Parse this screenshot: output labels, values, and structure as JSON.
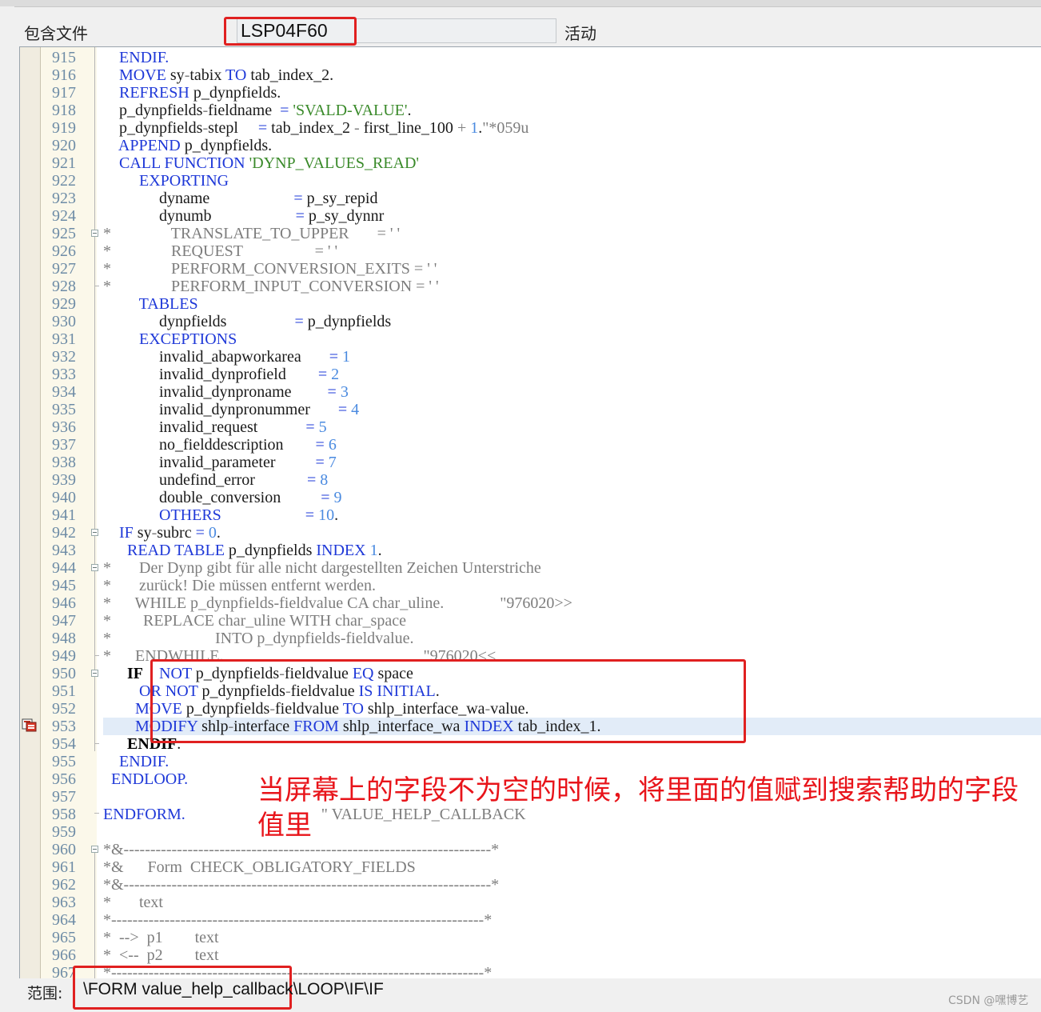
{
  "header": {
    "include_label": "包含文件",
    "include_value": "LSP04F60",
    "status": "活动"
  },
  "editor": {
    "breakpoint_line": "953",
    "lines": [
      {
        "n": "915",
        "t": [
          [
            "k",
            "    ENDIF."
          ]
        ]
      },
      {
        "n": "916",
        "t": [
          [
            "k",
            "    MOVE"
          ],
          [
            "p",
            " sy"
          ],
          [
            "c",
            "-"
          ],
          [
            "p",
            "tabix "
          ],
          [
            "k",
            "TO"
          ],
          [
            "p",
            " tab_index_2."
          ]
        ]
      },
      {
        "n": "917",
        "t": [
          [
            "k",
            "    REFRESH"
          ],
          [
            "p",
            " p_dynpfields."
          ]
        ]
      },
      {
        "n": "918",
        "t": [
          [
            "p",
            "    p_dynpfields"
          ],
          [
            "c",
            "-"
          ],
          [
            "p",
            "fieldname  "
          ],
          [
            "k",
            "="
          ],
          [
            "p",
            " "
          ],
          [
            "s",
            "'SVALD-VALUE'"
          ],
          [
            "p",
            "."
          ]
        ]
      },
      {
        "n": "919",
        "t": [
          [
            "p",
            "    p_dynpfields"
          ],
          [
            "c",
            "-"
          ],
          [
            "p",
            "stepl     "
          ],
          [
            "k",
            "="
          ],
          [
            "p",
            " tab_index_2 "
          ],
          [
            "c",
            "-"
          ],
          [
            "p",
            " first_line_100 "
          ],
          [
            "c",
            "+"
          ],
          [
            "p",
            " "
          ],
          [
            "n",
            "1"
          ],
          [
            "p",
            "."
          ],
          [
            "cm",
            "\"*059u"
          ]
        ]
      },
      {
        "n": "920",
        "t": [
          [
            "k",
            "    APPEND"
          ],
          [
            "p",
            " p_dynpfields."
          ]
        ]
      },
      {
        "n": "921",
        "t": [
          [
            "k",
            "    CALL FUNCTION"
          ],
          [
            "p",
            " "
          ],
          [
            "s",
            "'DYNP_VALUES_READ'"
          ]
        ]
      },
      {
        "n": "922",
        "t": [
          [
            "k",
            "         EXPORTING"
          ]
        ]
      },
      {
        "n": "923",
        "t": [
          [
            "p",
            "              dyname                     "
          ],
          [
            "k",
            "="
          ],
          [
            "p",
            " p_sy_repid"
          ]
        ]
      },
      {
        "n": "924",
        "t": [
          [
            "p",
            "              dynumb                     "
          ],
          [
            "k",
            "="
          ],
          [
            "p",
            " p_sy_dynnr"
          ]
        ]
      },
      {
        "n": "925",
        "t": [
          [
            "cm",
            "*               TRANSLATE_TO_UPPER       = ' '"
          ]
        ]
      },
      {
        "n": "926",
        "t": [
          [
            "cm",
            "*               REQUEST                  = ' '"
          ]
        ]
      },
      {
        "n": "927",
        "t": [
          [
            "cm",
            "*               PERFORM_CONVERSION_EXITS = ' '"
          ]
        ]
      },
      {
        "n": "928",
        "t": [
          [
            "cm",
            "*               PERFORM_INPUT_CONVERSION = ' '"
          ]
        ]
      },
      {
        "n": "929",
        "t": [
          [
            "k",
            "         TABLES"
          ]
        ]
      },
      {
        "n": "930",
        "t": [
          [
            "p",
            "              dynpfields                 "
          ],
          [
            "k",
            "="
          ],
          [
            "p",
            " p_dynpfields"
          ]
        ]
      },
      {
        "n": "931",
        "t": [
          [
            "k",
            "         EXCEPTIONS"
          ]
        ]
      },
      {
        "n": "932",
        "t": [
          [
            "p",
            "              invalid_abapworkarea       "
          ],
          [
            "k",
            "="
          ],
          [
            "p",
            " "
          ],
          [
            "n",
            "1"
          ]
        ]
      },
      {
        "n": "933",
        "t": [
          [
            "p",
            "              invalid_dynprofield        "
          ],
          [
            "k",
            "="
          ],
          [
            "p",
            " "
          ],
          [
            "n",
            "2"
          ]
        ]
      },
      {
        "n": "934",
        "t": [
          [
            "p",
            "              invalid_dynproname         "
          ],
          [
            "k",
            "="
          ],
          [
            "p",
            " "
          ],
          [
            "n",
            "3"
          ]
        ]
      },
      {
        "n": "935",
        "t": [
          [
            "p",
            "              invalid_dynpronummer       "
          ],
          [
            "k",
            "="
          ],
          [
            "p",
            " "
          ],
          [
            "n",
            "4"
          ]
        ]
      },
      {
        "n": "936",
        "t": [
          [
            "p",
            "              invalid_request            "
          ],
          [
            "k",
            "="
          ],
          [
            "p",
            " "
          ],
          [
            "n",
            "5"
          ]
        ]
      },
      {
        "n": "937",
        "t": [
          [
            "p",
            "              no_fielddescription        "
          ],
          [
            "k",
            "="
          ],
          [
            "p",
            " "
          ],
          [
            "n",
            "6"
          ]
        ]
      },
      {
        "n": "938",
        "t": [
          [
            "p",
            "              invalid_parameter          "
          ],
          [
            "k",
            "="
          ],
          [
            "p",
            " "
          ],
          [
            "n",
            "7"
          ]
        ]
      },
      {
        "n": "939",
        "t": [
          [
            "p",
            "              undefind_error             "
          ],
          [
            "k",
            "="
          ],
          [
            "p",
            " "
          ],
          [
            "n",
            "8"
          ]
        ]
      },
      {
        "n": "940",
        "t": [
          [
            "p",
            "              double_conversion          "
          ],
          [
            "k",
            "="
          ],
          [
            "p",
            " "
          ],
          [
            "n",
            "9"
          ]
        ]
      },
      {
        "n": "941",
        "t": [
          [
            "k",
            "              OTHERS                     ="
          ],
          [
            "p",
            " "
          ],
          [
            "n",
            "10"
          ],
          [
            "p",
            "."
          ]
        ]
      },
      {
        "n": "942",
        "t": [
          [
            "k",
            "    IF"
          ],
          [
            "p",
            " sy"
          ],
          [
            "c",
            "-"
          ],
          [
            "p",
            "subrc "
          ],
          [
            "k",
            "="
          ],
          [
            "p",
            " "
          ],
          [
            "n",
            "0"
          ],
          [
            "p",
            "."
          ]
        ]
      },
      {
        "n": "943",
        "t": [
          [
            "k",
            "      READ TABLE"
          ],
          [
            "p",
            " p_dynpfields "
          ],
          [
            "k",
            "INDEX"
          ],
          [
            "p",
            " "
          ],
          [
            "n",
            "1"
          ],
          [
            "p",
            "."
          ]
        ]
      },
      {
        "n": "944",
        "t": [
          [
            "cm",
            "*       Der Dynp gibt für alle nicht dargestellten Zeichen Unterstriche"
          ]
        ]
      },
      {
        "n": "945",
        "t": [
          [
            "cm",
            "*       zurück! Die müssen entfernt werden."
          ]
        ]
      },
      {
        "n": "946",
        "t": [
          [
            "cm",
            "*      WHILE p_dynpfields-fieldvalue CA char_uline.              \"976020>>"
          ]
        ]
      },
      {
        "n": "947",
        "t": [
          [
            "cm",
            "*        REPLACE char_uline WITH char_space"
          ]
        ]
      },
      {
        "n": "948",
        "t": [
          [
            "cm",
            "*                          INTO p_dynpfields-fieldvalue."
          ]
        ]
      },
      {
        "n": "949",
        "t": [
          [
            "cm",
            "*      ENDWHILE.                                                  \"976020<<"
          ]
        ]
      },
      {
        "n": "950",
        "t": [
          [
            "b",
            "      IF"
          ],
          [
            "p",
            "    "
          ],
          [
            "k",
            "NOT"
          ],
          [
            "p",
            " p_dynpfields"
          ],
          [
            "c",
            "-"
          ],
          [
            "p",
            "fieldvalue "
          ],
          [
            "k",
            "EQ"
          ],
          [
            "p",
            " space"
          ]
        ]
      },
      {
        "n": "951",
        "t": [
          [
            "k",
            "         OR NOT"
          ],
          [
            "p",
            " p_dynpfields"
          ],
          [
            "c",
            "-"
          ],
          [
            "p",
            "fieldvalue "
          ],
          [
            "k",
            "IS INITIAL"
          ],
          [
            "p",
            "."
          ]
        ]
      },
      {
        "n": "952",
        "t": [
          [
            "k",
            "        MOVE"
          ],
          [
            "p",
            " p_dynpfields"
          ],
          [
            "c",
            "-"
          ],
          [
            "p",
            "fieldvalue "
          ],
          [
            "k",
            "TO"
          ],
          [
            "p",
            " shlp_interface_wa"
          ],
          [
            "c",
            "-"
          ],
          [
            "p",
            "value."
          ]
        ]
      },
      {
        "n": "953",
        "t": [
          [
            "k",
            "        MODIFY"
          ],
          [
            "p",
            " shlp"
          ],
          [
            "c",
            "-"
          ],
          [
            "p",
            "interface "
          ],
          [
            "k",
            "FROM"
          ],
          [
            "p",
            " shlp_interface_wa "
          ],
          [
            "k",
            "INDEX"
          ],
          [
            "p",
            " tab_index_1."
          ]
        ]
      },
      {
        "n": "954",
        "t": [
          [
            "b",
            "      ENDIF"
          ],
          [
            "p",
            "."
          ]
        ]
      },
      {
        "n": "955",
        "t": [
          [
            "k",
            "    ENDIF."
          ]
        ]
      },
      {
        "n": "956",
        "t": [
          [
            "k",
            "  ENDLOOP."
          ]
        ]
      },
      {
        "n": "957",
        "t": []
      },
      {
        "n": "958",
        "t": [
          [
            "k",
            "ENDFORM."
          ],
          [
            "cm",
            "                                  \" VALUE_HELP_CALLBACK"
          ]
        ]
      },
      {
        "n": "959",
        "t": []
      },
      {
        "n": "960",
        "t": [
          [
            "cm",
            "*&---------------------------------------------------------------------*"
          ]
        ]
      },
      {
        "n": "961",
        "t": [
          [
            "cm",
            "*&      Form  CHECK_OBLIGATORY_FIELDS"
          ]
        ]
      },
      {
        "n": "962",
        "t": [
          [
            "cm",
            "*&---------------------------------------------------------------------*"
          ]
        ]
      },
      {
        "n": "963",
        "t": [
          [
            "cm",
            "*       text"
          ]
        ]
      },
      {
        "n": "964",
        "t": [
          [
            "cm",
            "*----------------------------------------------------------------------*"
          ]
        ]
      },
      {
        "n": "965",
        "t": [
          [
            "cm",
            "*  -->  p1        text"
          ]
        ]
      },
      {
        "n": "966",
        "t": [
          [
            "cm",
            "*  <--  p2        text"
          ]
        ]
      },
      {
        "n": "967",
        "t": [
          [
            "cm",
            "*----------------------------------------------------------------------*"
          ]
        ]
      }
    ]
  },
  "annotation": "当屏幕上的字段不为空的时候，将里面的值赋到搜索帮助的字段值里",
  "statusbar": {
    "scope_label": "范围:",
    "scope_value": "\\FORM value_help_callback\\LOOP\\IF\\IF"
  },
  "watermark": "CSDN @嘿博艺",
  "colors": {
    "keyword": "#1e38d8",
    "string": "#3a8a2a",
    "number": "#4a8ae0",
    "comment": "#7d7d7d",
    "highlight_box": "#e02020",
    "annotation_text": "#e8141a"
  }
}
